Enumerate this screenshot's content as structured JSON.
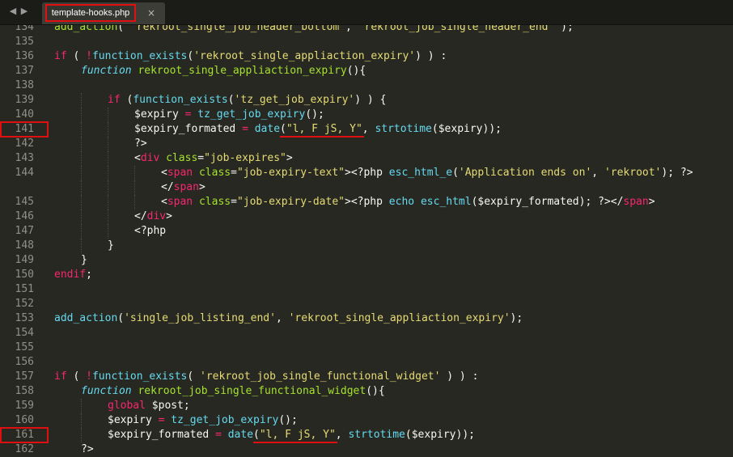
{
  "tabbar": {
    "nav_back": "◀",
    "nav_forward": "▶",
    "tab_name": "template-hooks.php",
    "tab_close": "×"
  },
  "lines": [
    {
      "n": "134",
      "indent": 0,
      "tokens": [
        [
          "name",
          "add_action"
        ],
        [
          "var",
          "( "
        ],
        [
          "str",
          "'rekroot_single_job_header_bottom'"
        ],
        [
          "var",
          ", "
        ],
        [
          "str",
          "'rekroot_job_single_header_end'"
        ],
        [
          "var",
          " );"
        ]
      ]
    },
    {
      "n": "135",
      "indent": 0,
      "tokens": []
    },
    {
      "n": "136",
      "indent": 0,
      "tokens": [
        [
          "kw",
          "if"
        ],
        [
          "var",
          " ( "
        ],
        [
          "kw",
          "!"
        ],
        [
          "fn",
          "function_exists"
        ],
        [
          "var",
          "("
        ],
        [
          "str",
          "'rekroot_single_appliaction_expiry'"
        ],
        [
          "var",
          ") ) :"
        ]
      ]
    },
    {
      "n": "137",
      "indent": 1,
      "tokens": [
        [
          "it",
          "function"
        ],
        [
          "var",
          " "
        ],
        [
          "name",
          "rekroot_single_appliaction_expiry"
        ],
        [
          "var",
          "(){"
        ]
      ]
    },
    {
      "n": "138",
      "indent": 0,
      "tokens": []
    },
    {
      "n": "139",
      "indent": 2,
      "tokens": [
        [
          "kw",
          "if"
        ],
        [
          "var",
          " ("
        ],
        [
          "fn",
          "function_exists"
        ],
        [
          "var",
          "("
        ],
        [
          "str",
          "'tz_get_job_expiry'"
        ],
        [
          "var",
          ") ) {"
        ]
      ]
    },
    {
      "n": "140",
      "indent": 3,
      "tokens": [
        [
          "var",
          "$expiry "
        ],
        [
          "kw",
          "="
        ],
        [
          "var",
          " "
        ],
        [
          "fn",
          "tz_get_job_expiry"
        ],
        [
          "var",
          "();"
        ]
      ]
    },
    {
      "n": "141",
      "indent": 3,
      "tokens": [
        [
          "var",
          "$expiry_formated "
        ],
        [
          "kw",
          "="
        ],
        [
          "var",
          " "
        ],
        [
          "fn",
          "date"
        ],
        [
          "var",
          "("
        ],
        [
          "str",
          "\"l, F jS, Y\""
        ],
        [
          "var",
          ", "
        ],
        [
          "fn",
          "strtotime"
        ],
        [
          "var",
          "($expiry));"
        ]
      ]
    },
    {
      "n": "142",
      "indent": 3,
      "tokens": [
        [
          "var",
          "?>"
        ]
      ]
    },
    {
      "n": "143",
      "indent": 3,
      "tokens": [
        [
          "var",
          "<"
        ],
        [
          "kw",
          "div"
        ],
        [
          "var",
          " "
        ],
        [
          "attr",
          "class"
        ],
        [
          "var",
          "="
        ],
        [
          "str",
          "\"job-expires\""
        ],
        [
          "var",
          ">"
        ]
      ]
    },
    {
      "n": "144",
      "indent": 4,
      "tokens": [
        [
          "var",
          "<"
        ],
        [
          "kw",
          "span"
        ],
        [
          "var",
          " "
        ],
        [
          "attr",
          "class"
        ],
        [
          "var",
          "="
        ],
        [
          "str",
          "\"job-expiry-text\""
        ],
        [
          "var",
          ">"
        ],
        [
          "var",
          "<?php "
        ],
        [
          "fn",
          "esc_html_e"
        ],
        [
          "var",
          "("
        ],
        [
          "str",
          "'Application ends on'"
        ],
        [
          "var",
          ", "
        ],
        [
          "str",
          "'rekroot'"
        ],
        [
          "var",
          "); ?>"
        ]
      ]
    },
    {
      "n": "",
      "indent": 4,
      "tokens": [
        [
          "var",
          "</"
        ],
        [
          "kw",
          "span"
        ],
        [
          "var",
          ">"
        ]
      ]
    },
    {
      "n": "145",
      "indent": 4,
      "tokens": [
        [
          "var",
          "<"
        ],
        [
          "kw",
          "span"
        ],
        [
          "var",
          " "
        ],
        [
          "attr",
          "class"
        ],
        [
          "var",
          "="
        ],
        [
          "str",
          "\"job-expiry-date\""
        ],
        [
          "var",
          ">"
        ],
        [
          "var",
          "<?php "
        ],
        [
          "fn",
          "echo"
        ],
        [
          "var",
          " "
        ],
        [
          "fn",
          "esc_html"
        ],
        [
          "var",
          "($expiry_formated); ?></"
        ],
        [
          "kw",
          "span"
        ],
        [
          "var",
          ">"
        ]
      ]
    },
    {
      "n": "146",
      "indent": 3,
      "tokens": [
        [
          "var",
          "</"
        ],
        [
          "kw",
          "div"
        ],
        [
          "var",
          ">"
        ]
      ]
    },
    {
      "n": "147",
      "indent": 3,
      "tokens": [
        [
          "var",
          "<?php"
        ]
      ]
    },
    {
      "n": "148",
      "indent": 2,
      "tokens": [
        [
          "var",
          "}"
        ]
      ]
    },
    {
      "n": "149",
      "indent": 1,
      "tokens": [
        [
          "var",
          "}"
        ]
      ]
    },
    {
      "n": "150",
      "indent": 0,
      "tokens": [
        [
          "kw",
          "endif"
        ],
        [
          "var",
          ";"
        ]
      ]
    },
    {
      "n": "151",
      "indent": 0,
      "tokens": []
    },
    {
      "n": "152",
      "indent": 0,
      "tokens": []
    },
    {
      "n": "153",
      "indent": 0,
      "tokens": [
        [
          "fn",
          "add_action"
        ],
        [
          "var",
          "("
        ],
        [
          "str",
          "'single_job_listing_end'"
        ],
        [
          "var",
          ", "
        ],
        [
          "str",
          "'rekroot_single_appliaction_expiry'"
        ],
        [
          "var",
          ");"
        ]
      ]
    },
    {
      "n": "154",
      "indent": 0,
      "tokens": []
    },
    {
      "n": "155",
      "indent": 0,
      "tokens": []
    },
    {
      "n": "156",
      "indent": 0,
      "tokens": []
    },
    {
      "n": "157",
      "indent": 0,
      "tokens": [
        [
          "kw",
          "if"
        ],
        [
          "var",
          " ( "
        ],
        [
          "kw",
          "!"
        ],
        [
          "fn",
          "function_exists"
        ],
        [
          "var",
          "( "
        ],
        [
          "str",
          "'rekroot_job_single_functional_widget'"
        ],
        [
          "var",
          " ) ) :"
        ]
      ]
    },
    {
      "n": "158",
      "indent": 1,
      "tokens": [
        [
          "it",
          "function"
        ],
        [
          "var",
          " "
        ],
        [
          "name",
          "rekroot_job_single_functional_widget"
        ],
        [
          "var",
          "(){"
        ]
      ]
    },
    {
      "n": "159",
      "indent": 2,
      "tokens": [
        [
          "kw",
          "global"
        ],
        [
          "var",
          " $post;"
        ]
      ]
    },
    {
      "n": "160",
      "indent": 2,
      "tokens": [
        [
          "var",
          "$expiry "
        ],
        [
          "kw",
          "="
        ],
        [
          "var",
          " "
        ],
        [
          "fn",
          "tz_get_job_expiry"
        ],
        [
          "var",
          "();"
        ]
      ]
    },
    {
      "n": "161",
      "indent": 2,
      "tokens": [
        [
          "var",
          "$expiry_formated "
        ],
        [
          "kw",
          "="
        ],
        [
          "var",
          " "
        ],
        [
          "fn",
          "date"
        ],
        [
          "var",
          "("
        ],
        [
          "str",
          "\"l, F jS, Y\""
        ],
        [
          "var",
          ", "
        ],
        [
          "fn",
          "strtotime"
        ],
        [
          "var",
          "($expiry));"
        ]
      ]
    },
    {
      "n": "162",
      "indent": 1,
      "tokens": [
        [
          "var",
          "?>"
        ]
      ]
    }
  ],
  "highlighted_lines": [
    "141",
    "161"
  ],
  "colors": {
    "background": "#272822",
    "keyword": "#f92672",
    "function": "#66d9ef",
    "string": "#e6db74",
    "name": "#a6e22e",
    "line_number": "#8f908a",
    "annotation": "#e01010"
  }
}
